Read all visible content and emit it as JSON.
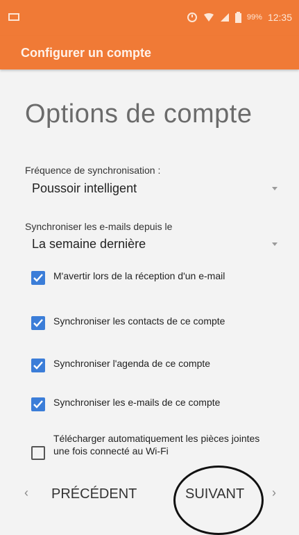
{
  "status_bar": {
    "battery": "99%",
    "time": "12:35"
  },
  "app_bar": {
    "title": "Configurer un compte"
  },
  "page": {
    "title": "Options de compte"
  },
  "sync_frequency": {
    "label": "Fréquence de synchronisation :",
    "value": "Poussoir intelligent"
  },
  "sync_since": {
    "label": "Synchroniser les e-mails depuis le",
    "value": "La semaine dernière"
  },
  "options": [
    {
      "label": "M'avertir lors de la réception d'un e-mail",
      "checked": true
    },
    {
      "label": "Synchroniser les contacts de ce compte",
      "checked": true
    },
    {
      "label": "Synchroniser l'agenda de ce compte",
      "checked": true
    },
    {
      "label": "Synchroniser les e-mails de ce compte",
      "checked": true
    },
    {
      "label": "Télécharger automatiquement les pièces jointes une fois connecté au Wi-Fi",
      "checked": false
    }
  ],
  "navigation": {
    "previous_label": "PRÉCÉDENT",
    "next_label": "SUIVANT"
  },
  "colors": {
    "accent": "#f07a36",
    "checkbox": "#3b7dd8"
  }
}
